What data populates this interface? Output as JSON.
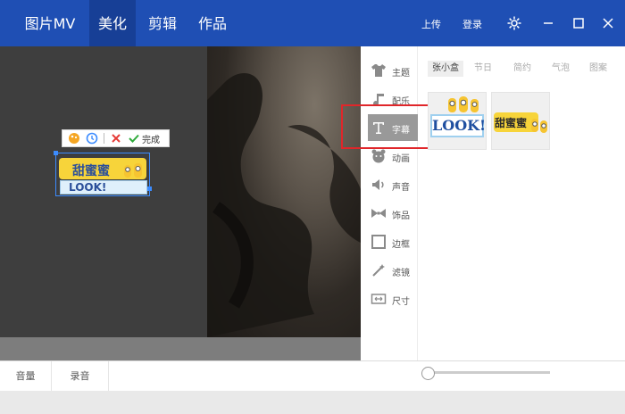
{
  "topnav": {
    "app_title": "图片MV",
    "tabs": [
      {
        "label": "美化",
        "active": true
      },
      {
        "label": "剪辑",
        "active": false
      },
      {
        "label": "作品",
        "active": false
      }
    ],
    "upload_label": "上传",
    "login_label": "登录"
  },
  "caption_toolbar": {
    "done_label": "完成"
  },
  "caption_preview": {
    "main_text": "甜蜜蜜",
    "under_text": "LOOK!"
  },
  "side_nav": {
    "items": [
      {
        "label": "主题",
        "icon": "shirt-icon"
      },
      {
        "label": "配乐",
        "icon": "music-note-icon"
      },
      {
        "label": "字幕",
        "icon": "text-t-icon",
        "active": true
      },
      {
        "label": "动画",
        "icon": "bear-face-icon"
      },
      {
        "label": "声音",
        "icon": "speaker-icon"
      },
      {
        "label": "饰品",
        "icon": "bow-icon"
      },
      {
        "label": "边框",
        "icon": "frame-icon"
      },
      {
        "label": "滤镜",
        "icon": "magic-wand-icon"
      },
      {
        "label": "尺寸",
        "icon": "resize-icon"
      }
    ]
  },
  "category_tabs": [
    {
      "label": "张小盒",
      "active": true
    },
    {
      "label": "节日"
    },
    {
      "label": "简约"
    },
    {
      "label": "气泡"
    },
    {
      "label": "图案"
    }
  ],
  "stickers": [
    {
      "text": "LOOK!"
    },
    {
      "text": "甜蜜蜜"
    }
  ],
  "bottom": {
    "volume_label": "音量",
    "record_label": "录音"
  },
  "colors": {
    "brand_blue": "#1f4fb4",
    "active_nav": "#173f96",
    "highlight_red": "#e0262a",
    "selection_blue": "#3c8cff"
  }
}
